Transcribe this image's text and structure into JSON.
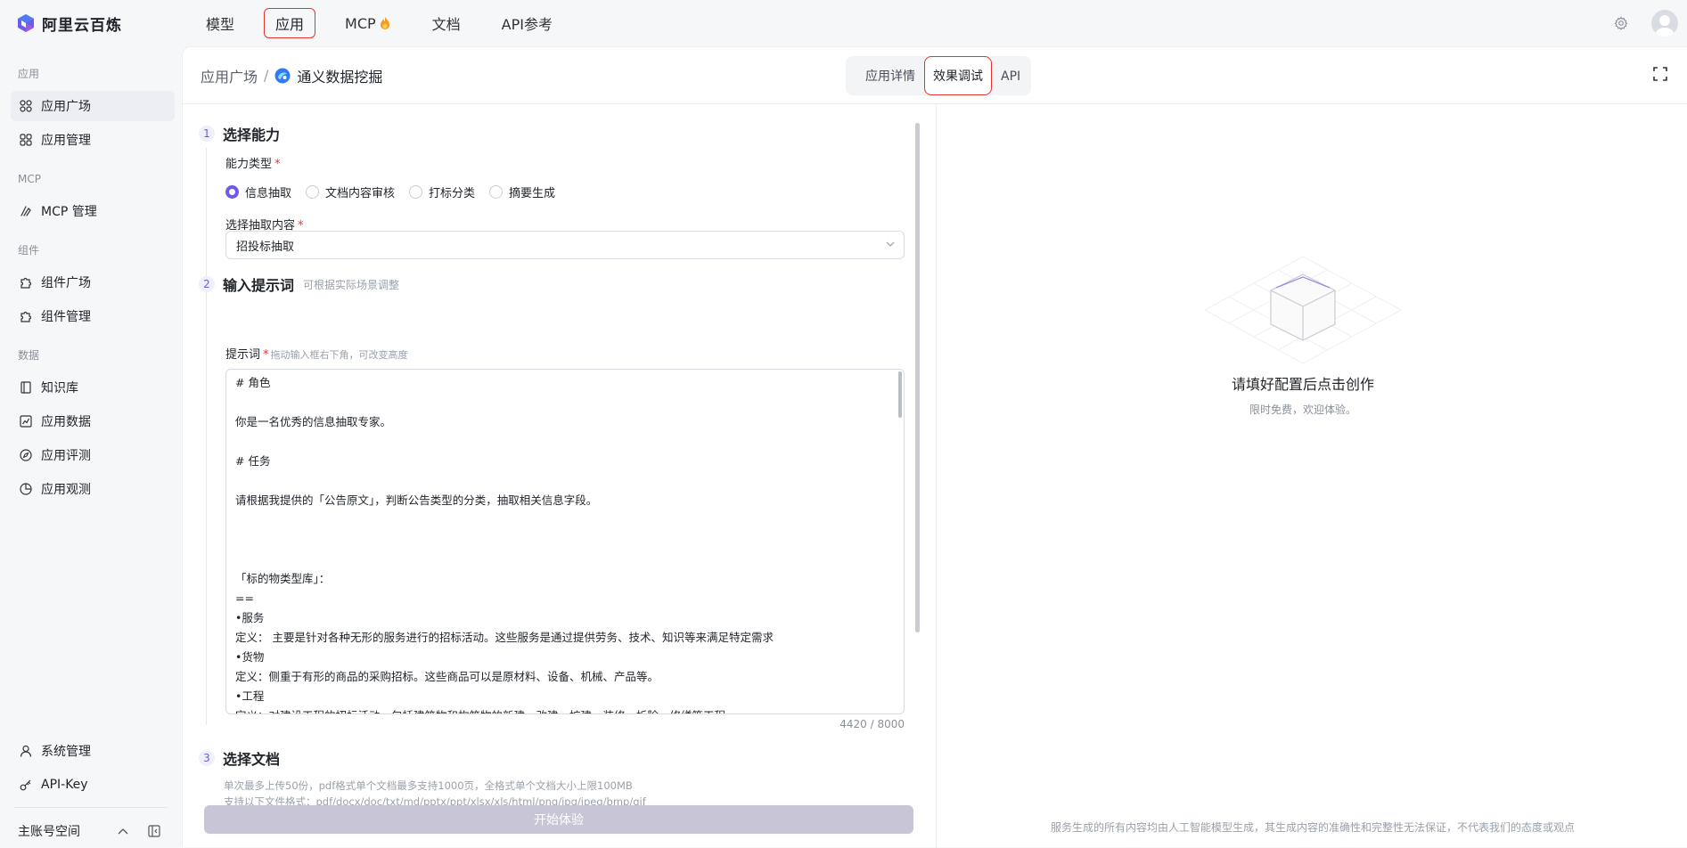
{
  "brand": {
    "name": "阿里云百炼"
  },
  "topnav": {
    "items": [
      {
        "label": "模型",
        "active": false
      },
      {
        "label": "应用",
        "active": true
      },
      {
        "label": "MCP",
        "active": false,
        "icon": "fire-emoji"
      },
      {
        "label": "文档",
        "active": false
      },
      {
        "label": "API参考",
        "active": false
      }
    ]
  },
  "sidebar": {
    "groups": [
      {
        "title": "应用",
        "items": [
          {
            "label": "应用广场",
            "icon": "apps-icon",
            "active": true
          },
          {
            "label": "应用管理",
            "icon": "apps-icon"
          }
        ]
      },
      {
        "title": "MCP",
        "items": [
          {
            "label": "MCP 管理",
            "icon": "mcp-icon"
          }
        ]
      },
      {
        "title": "组件",
        "items": [
          {
            "label": "组件广场",
            "icon": "puzzle-icon"
          },
          {
            "label": "组件管理",
            "icon": "puzzle-icon"
          }
        ]
      },
      {
        "title": "数据",
        "items": [
          {
            "label": "知识库",
            "icon": "book-icon"
          },
          {
            "label": "应用数据",
            "icon": "chart-icon"
          },
          {
            "label": "应用评测",
            "icon": "compass-icon"
          },
          {
            "label": "应用观测",
            "icon": "pie-icon"
          }
        ]
      }
    ],
    "bottom_items": [
      {
        "label": "系统管理",
        "icon": "user-icon"
      },
      {
        "label": "API-Key",
        "icon": "key-icon"
      }
    ],
    "account": "主账号空间"
  },
  "breadcrumb": {
    "parent": "应用广场",
    "sep": "/",
    "current": "通义数据挖掘"
  },
  "tabs": [
    {
      "label": "应用详情",
      "active": false
    },
    {
      "label": "效果调试",
      "active": true
    },
    {
      "label": "API",
      "active": false
    }
  ],
  "config": {
    "step1": {
      "num": "1",
      "title": "选择能力"
    },
    "ability_label": "能力类型",
    "ability_options": [
      {
        "label": "信息抽取",
        "checked": true
      },
      {
        "label": "文档内容审核",
        "checked": false
      },
      {
        "label": "打标分类",
        "checked": false
      },
      {
        "label": "摘要生成",
        "checked": false
      }
    ],
    "extract_label": "选择抽取内容",
    "extract_value": "招投标抽取",
    "step2": {
      "num": "2",
      "title": "输入提示词",
      "hint": "可根据实际场景调整"
    },
    "prompt_label": "提示词",
    "prompt_hint": "拖动输入框右下角，可改变高度",
    "prompt_lines": [
      "# 角色",
      "",
      "你是一名优秀的信息抽取专家。",
      "",
      "# 任务",
      "",
      "请根据我提供的「公告原文」，判断公告类型的分类，抽取相关信息字段。",
      "",
      "",
      "",
      "「标的物类型库」：",
      "==",
      "•服务",
      "定义： 主要是针对各种无形的服务进行的招标活动。这些服务是通过提供劳务、技术、知识等来满足特定需求",
      "•货物",
      "定义：侧重于有形的商品的采购招标。这些商品可以是原材料、设备、机械、产品等。",
      "•工程",
      "定义：对建设工程的招标活动，包括建筑物和构筑物的新建、改建、扩建、装修、拆除、修缮等工程"
    ],
    "counter": "4420 / 8000",
    "step3": {
      "num": "3",
      "title": "选择文档"
    },
    "upload_hint1": "单次最多上传50份，pdf格式单个文档最多支持1000页，全格式单个文档大小上限100MB",
    "upload_hint2": "支持以下文件格式：pdf/docx/doc/txt/md/pptx/ppt/xlsx/xls/html/png/jpg/jpeg/bmp/gif",
    "start_button": "开始体验"
  },
  "preview": {
    "empty_title": "请填好配置后点击创作",
    "empty_sub": "限时免费，欢迎体验。",
    "disclaimer": "服务生成的所有内容均由人工智能模型生成，其生成内容的准确性和完整性无法保证，不代表我们的态度或观点"
  },
  "colors": {
    "accent": "#6c5ce7",
    "highlight": "#e8322f",
    "button_disabled": "#c8c6d6"
  }
}
